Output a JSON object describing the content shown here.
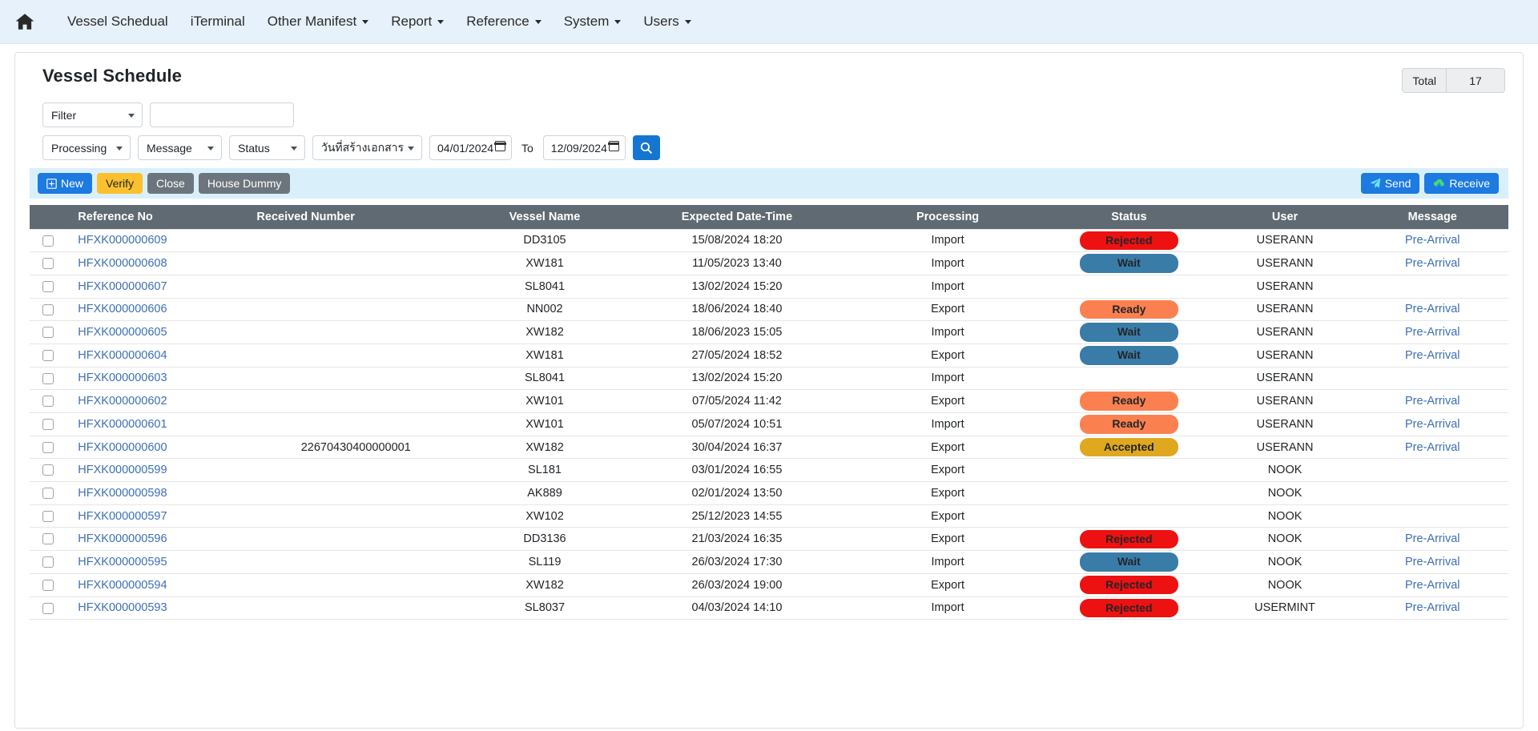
{
  "navbar": {
    "home_icon": "home-icon",
    "items": [
      {
        "label": "Vessel Schedual",
        "has_caret": false
      },
      {
        "label": "iTerminal",
        "has_caret": false
      },
      {
        "label": "Other Manifest",
        "has_caret": true
      },
      {
        "label": "Report",
        "has_caret": true
      },
      {
        "label": "Reference",
        "has_caret": true
      },
      {
        "label": "System",
        "has_caret": true
      },
      {
        "label": "Users",
        "has_caret": true
      }
    ]
  },
  "page": {
    "title": "Vessel Schedule",
    "total_label": "Total",
    "total_value": "17"
  },
  "filters": {
    "filter_select": "Filter",
    "keyword_value": "",
    "keyword_placeholder": "",
    "processing_select": "Processing",
    "message_select": "Message",
    "status_select": "Status",
    "date_type_select": "วันที่สร้างเอกสาร",
    "date_from": "04/01/2024",
    "to_label": "To",
    "date_to": "12/09/2024",
    "search_icon": "search-icon"
  },
  "toolbar": {
    "new_label": "New",
    "verify_label": "Verify",
    "close_label": "Close",
    "house_dummy_label": "House Dummy",
    "send_label": "Send",
    "receive_label": "Receive"
  },
  "table": {
    "columns": [
      "",
      "Reference No",
      "Received Number",
      "Vessel Name",
      "Expected Date-Time",
      "Processing",
      "Status",
      "User",
      "Message"
    ],
    "status_colors": {
      "Rejected": "#ee1111",
      "Wait": "#3a7ca8",
      "Ready": "#fb8050",
      "Accepted": "#e0a81e"
    },
    "rows": [
      {
        "ref": "HFXK000000609",
        "received": "",
        "vessel": "DD3105",
        "expected": "15/08/2024 18:20",
        "processing": "Import",
        "status": "Rejected",
        "user": "USERANN",
        "message": "Pre-Arrival"
      },
      {
        "ref": "HFXK000000608",
        "received": "",
        "vessel": "XW181",
        "expected": "11/05/2023 13:40",
        "processing": "Import",
        "status": "Wait",
        "user": "USERANN",
        "message": "Pre-Arrival"
      },
      {
        "ref": "HFXK000000607",
        "received": "",
        "vessel": "SL8041",
        "expected": "13/02/2024 15:20",
        "processing": "Import",
        "status": "",
        "user": "USERANN",
        "message": ""
      },
      {
        "ref": "HFXK000000606",
        "received": "",
        "vessel": "NN002",
        "expected": "18/06/2024 18:40",
        "processing": "Export",
        "status": "Ready",
        "user": "USERANN",
        "message": "Pre-Arrival"
      },
      {
        "ref": "HFXK000000605",
        "received": "",
        "vessel": "XW182",
        "expected": "18/06/2023 15:05",
        "processing": "Import",
        "status": "Wait",
        "user": "USERANN",
        "message": "Pre-Arrival"
      },
      {
        "ref": "HFXK000000604",
        "received": "",
        "vessel": "XW181",
        "expected": "27/05/2024 18:52",
        "processing": "Export",
        "status": "Wait",
        "user": "USERANN",
        "message": "Pre-Arrival"
      },
      {
        "ref": "HFXK000000603",
        "received": "",
        "vessel": "SL8041",
        "expected": "13/02/2024 15:20",
        "processing": "Import",
        "status": "",
        "user": "USERANN",
        "message": ""
      },
      {
        "ref": "HFXK000000602",
        "received": "",
        "vessel": "XW101",
        "expected": "07/05/2024 11:42",
        "processing": "Export",
        "status": "Ready",
        "user": "USERANN",
        "message": "Pre-Arrival"
      },
      {
        "ref": "HFXK000000601",
        "received": "",
        "vessel": "XW101",
        "expected": "05/07/2024 10:51",
        "processing": "Import",
        "status": "Ready",
        "user": "USERANN",
        "message": "Pre-Arrival"
      },
      {
        "ref": "HFXK000000600",
        "received": "22670430400000001",
        "vessel": "XW182",
        "expected": "30/04/2024 16:37",
        "processing": "Export",
        "status": "Accepted",
        "user": "USERANN",
        "message": "Pre-Arrival"
      },
      {
        "ref": "HFXK000000599",
        "received": "",
        "vessel": "SL181",
        "expected": "03/01/2024 16:55",
        "processing": "Export",
        "status": "",
        "user": "NOOK",
        "message": ""
      },
      {
        "ref": "HFXK000000598",
        "received": "",
        "vessel": "AK889",
        "expected": "02/01/2024 13:50",
        "processing": "Export",
        "status": "",
        "user": "NOOK",
        "message": ""
      },
      {
        "ref": "HFXK000000597",
        "received": "",
        "vessel": "XW102",
        "expected": "25/12/2023 14:55",
        "processing": "Export",
        "status": "",
        "user": "NOOK",
        "message": ""
      },
      {
        "ref": "HFXK000000596",
        "received": "",
        "vessel": "DD3136",
        "expected": "21/03/2024 16:35",
        "processing": "Export",
        "status": "Rejected",
        "user": "NOOK",
        "message": "Pre-Arrival"
      },
      {
        "ref": "HFXK000000595",
        "received": "",
        "vessel": "SL119",
        "expected": "26/03/2024 17:30",
        "processing": "Import",
        "status": "Wait",
        "user": "NOOK",
        "message": "Pre-Arrival"
      },
      {
        "ref": "HFXK000000594",
        "received": "",
        "vessel": "XW182",
        "expected": "26/03/2024 19:00",
        "processing": "Export",
        "status": "Rejected",
        "user": "NOOK",
        "message": "Pre-Arrival"
      },
      {
        "ref": "HFXK000000593",
        "received": "",
        "vessel": "SL8037",
        "expected": "04/03/2024 14:10",
        "processing": "Import",
        "status": "Rejected",
        "user": "USERMINT",
        "message": "Pre-Arrival"
      }
    ]
  }
}
